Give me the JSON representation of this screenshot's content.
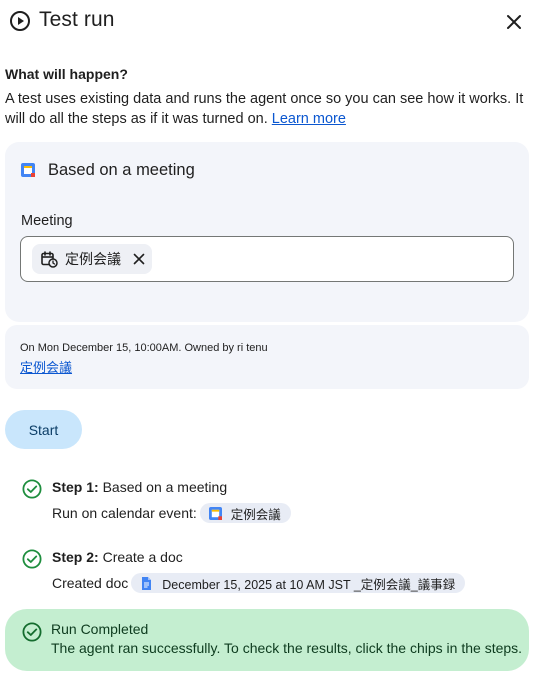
{
  "header": {
    "title": "Test run"
  },
  "intro": {
    "heading": "What will happen?",
    "text": "A test uses existing data and runs the agent once so you can see how it works. It will do all the steps as if it was turned on. ",
    "learn_more": "Learn more"
  },
  "trigger": {
    "title": "Based on a meeting",
    "meeting_label": "Meeting",
    "selected_meeting": "定例会議"
  },
  "event": {
    "meta": "On Mon December 15, 10:00AM. Owned by ri tenu",
    "link": "定例会議"
  },
  "start_label": "Start",
  "steps": [
    {
      "label": "Step 1:",
      "title": " Based on a meeting",
      "detail": "Run on calendar event:",
      "chip": "定例会議",
      "chip_icon": "calendar-icon"
    },
    {
      "label": "Step 2:",
      "title": " Create a doc",
      "detail": "Created doc",
      "chip": "December 15, 2025 at 10 AM JST _定例会議_議事録",
      "chip_icon": "docs-icon"
    }
  ],
  "completion": {
    "title": "Run Completed",
    "text": "The agent ran successfully. To check the results, click the chips in the steps."
  },
  "colors": {
    "accent": "#0b57d0",
    "success": "#1e8e3e",
    "banner": "#c4eed0",
    "card": "#f3f5fa"
  }
}
